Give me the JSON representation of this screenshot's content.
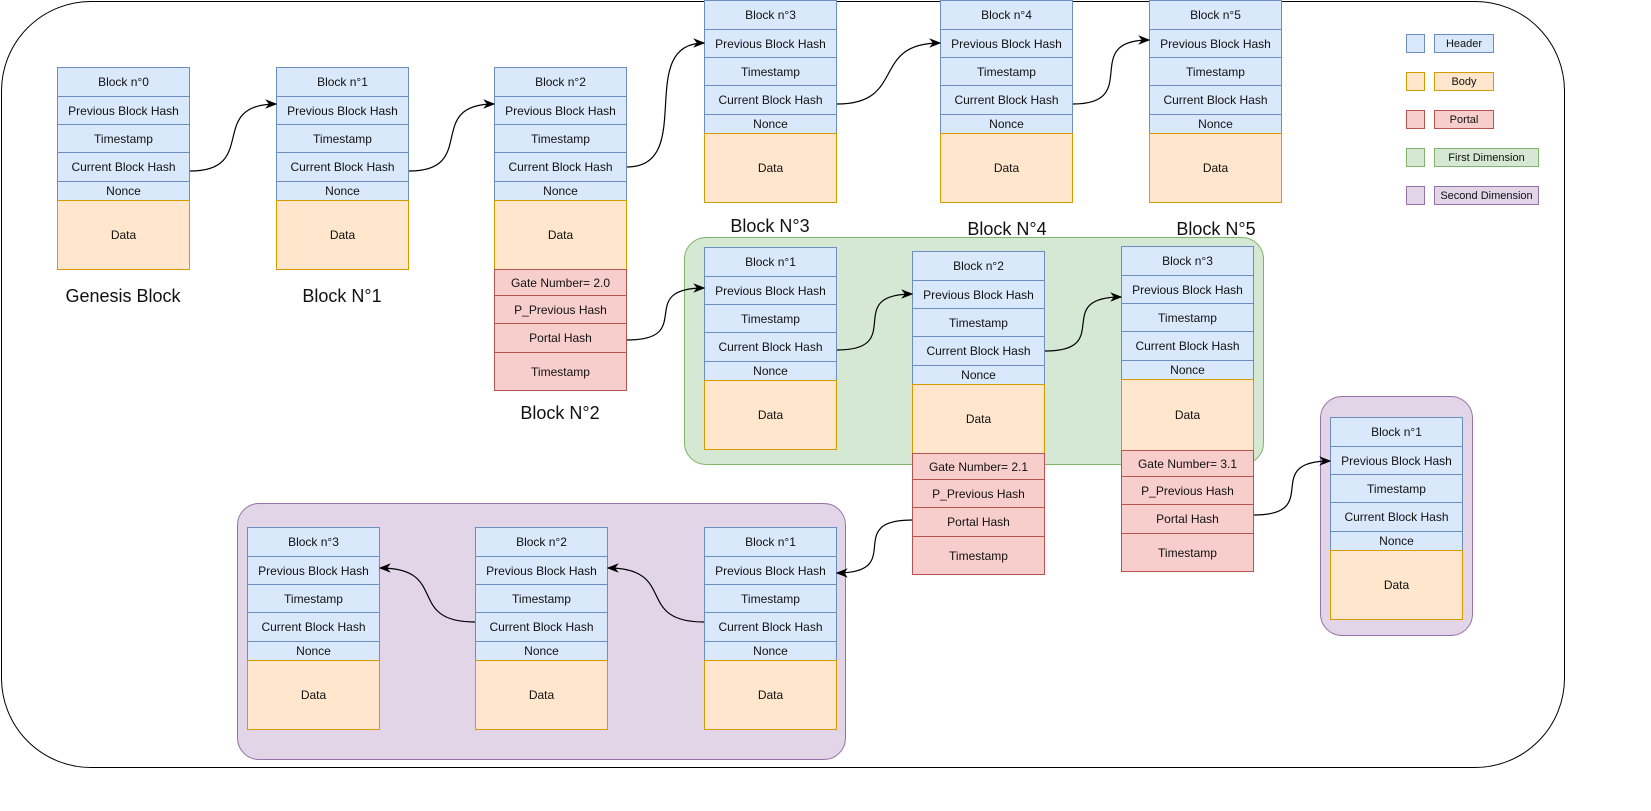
{
  "field_labels": {
    "previous_hash": "Previous Block Hash",
    "timestamp": "Timestamp",
    "current_hash": "Current Block Hash",
    "nonce": "Nonce",
    "data": "Data",
    "p_previous_hash": "P_Previous Hash",
    "portal_hash": "Portal Hash",
    "portal_timestamp": "Timestamp"
  },
  "main_chain": [
    {
      "title": "Block n°0",
      "caption": "Genesis Block"
    },
    {
      "title": "Block n°1",
      "caption": "Block N°1"
    },
    {
      "title": "Block n°2",
      "caption": "Block N°2",
      "gate_number": "Gate Number= 2.0"
    },
    {
      "title": "Block n°3",
      "caption": "Block N°3"
    },
    {
      "title": "Block n°4",
      "caption": "Block N°4"
    },
    {
      "title": "Block n°5",
      "caption": "Block N°5"
    }
  ],
  "first_dimension": [
    {
      "title": "Block n°1"
    },
    {
      "title": "Block n°2",
      "gate_number": "Gate Number= 2.1"
    },
    {
      "title": "Block n°3",
      "gate_number": "Gate Number= 3.1"
    }
  ],
  "second_dimension_a": [
    {
      "title": "Block n°3"
    },
    {
      "title": "Block n°2"
    },
    {
      "title": "Block n°1"
    }
  ],
  "second_dimension_b": [
    {
      "title": "Block n°1"
    }
  ],
  "legend": [
    {
      "label": "Header",
      "fill": "#dae8fc",
      "stroke": "#6c8ebf"
    },
    {
      "label": "Body",
      "fill": "#ffe6cc",
      "stroke": "#d79b00"
    },
    {
      "label": "Portal",
      "fill": "#f8cecc",
      "stroke": "#b85450"
    },
    {
      "label": "First Dimension",
      "fill": "#d5e8d4",
      "stroke": "#82b366"
    },
    {
      "label": "Second Dimension",
      "fill": "#e1d5e7",
      "stroke": "#9673a6"
    }
  ]
}
